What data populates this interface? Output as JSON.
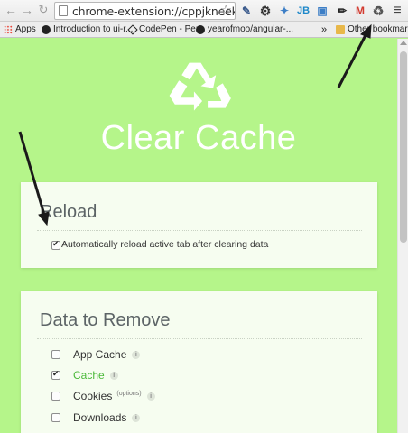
{
  "browser": {
    "url": "chrome-extension://cppjkneekbjaee",
    "extensions": [
      {
        "icon": "eyedropper-icon",
        "text": "✎"
      },
      {
        "icon": "gear-icon",
        "text": "⚙"
      },
      {
        "icon": "satellite-icon",
        "text": "✦"
      },
      {
        "icon": "jb-icon",
        "text": "JB"
      },
      {
        "icon": "window-icon",
        "text": "▣"
      },
      {
        "icon": "pen-icon",
        "text": "✏"
      },
      {
        "icon": "gmail-icon",
        "text": "M"
      },
      {
        "icon": "recycle-icon",
        "text": "♻"
      },
      {
        "icon": "menu-icon",
        "text": "≡"
      }
    ],
    "bookmarks": [
      {
        "label": "Apps",
        "icon": "apps-grid-icon"
      },
      {
        "label": "Introduction to ui-r...",
        "icon": "github-icon"
      },
      {
        "label": "CodePen - Pen",
        "icon": "codepen-icon"
      },
      {
        "label": "yearofmoo/angular-...",
        "icon": "github-icon"
      }
    ],
    "overflow": "»",
    "other_bookmarks": "Other bookmarks"
  },
  "app": {
    "title": "Clear Cache",
    "accent": "#b5f58a"
  },
  "reload": {
    "heading": "Reload",
    "auto_reload_label": "Automatically reload active tab after clearing data",
    "auto_reload_checked": true
  },
  "remove": {
    "heading": "Data to Remove",
    "options": [
      {
        "label": "App Cache",
        "checked": false,
        "info": "i",
        "extra": ""
      },
      {
        "label": "Cache",
        "checked": true,
        "info": "i",
        "extra": ""
      },
      {
        "label": "Cookies",
        "checked": false,
        "info": "i",
        "extra": "(options)"
      },
      {
        "label": "Downloads",
        "checked": false,
        "info": "i",
        "extra": ""
      }
    ]
  }
}
